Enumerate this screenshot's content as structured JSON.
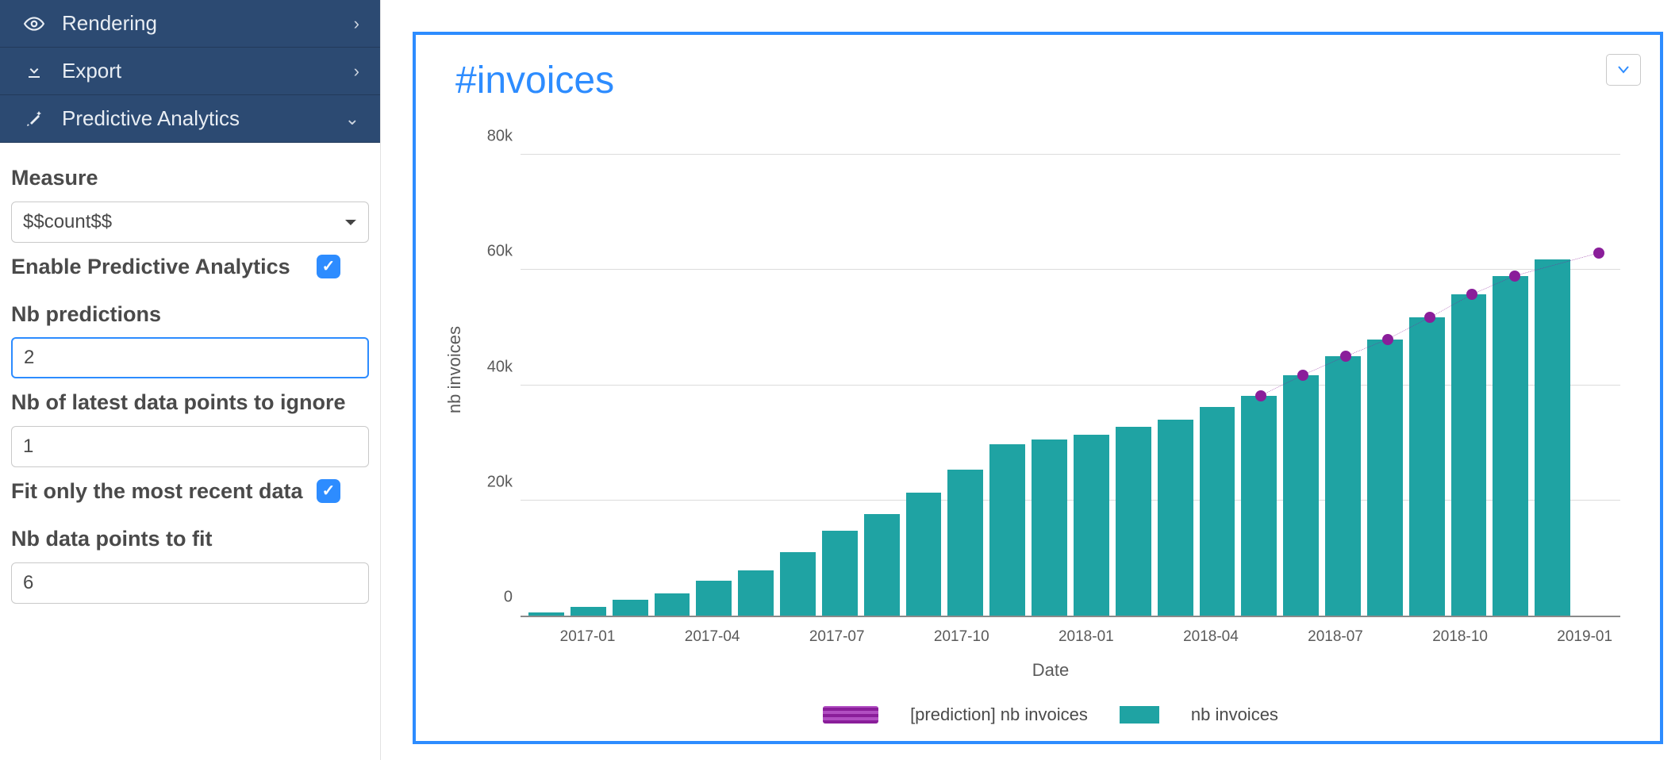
{
  "sidebar": {
    "nav": [
      {
        "label": "Rendering",
        "icon": "eye",
        "state": "collapsed"
      },
      {
        "label": "Export",
        "icon": "download",
        "state": "collapsed"
      },
      {
        "label": "Predictive Analytics",
        "icon": "wand",
        "state": "expanded"
      }
    ],
    "fields": {
      "measure_label": "Measure",
      "measure_value": "$$count$$",
      "enable_label": "Enable Predictive Analytics",
      "enable_checked": true,
      "nb_predictions_label": "Nb predictions",
      "nb_predictions_value": "2",
      "nb_ignore_label": "Nb of latest data points to ignore",
      "nb_ignore_value": "1",
      "fit_recent_label": "Fit only the most recent data",
      "fit_recent_checked": true,
      "nb_fit_label": "Nb data points to fit",
      "nb_fit_value": "6"
    }
  },
  "chart": {
    "title": "#invoices",
    "xlabel": "Date",
    "ylabel": "nb invoices",
    "legend_prediction": "[prediction] nb invoices",
    "legend_bar": "nb invoices"
  },
  "chart_data": {
    "type": "bar",
    "title": "#invoices",
    "xlabel": "Date",
    "ylabel": "nb invoices",
    "ylim": [
      0,
      85000
    ],
    "yticks": [
      0,
      20000,
      40000,
      60000,
      80000
    ],
    "ytick_labels": [
      "0",
      "20k",
      "40k",
      "60k",
      "80k"
    ],
    "categories": [
      "2016-12",
      "2017-01",
      "2017-02",
      "2017-03",
      "2017-04",
      "2017-05",
      "2017-06",
      "2017-07",
      "2017-08",
      "2017-09",
      "2017-10",
      "2017-11",
      "2017-12",
      "2018-01",
      "2018-02",
      "2018-03",
      "2018-04",
      "2018-05",
      "2018-06",
      "2018-07",
      "2018-08",
      "2018-09",
      "2018-10",
      "2018-11",
      "2018-12",
      "2019-01"
    ],
    "xtick_show": [
      "",
      "2017-01",
      "",
      "",
      "2017-04",
      "",
      "",
      "2017-07",
      "",
      "",
      "2017-10",
      "",
      "",
      "2018-01",
      "",
      "",
      "2018-04",
      "",
      "",
      "2018-07",
      "",
      "",
      "2018-10",
      "",
      "",
      "2019-01"
    ],
    "series": [
      {
        "name": "nb invoices",
        "type": "bar",
        "color": "#1fa3a3",
        "values": [
          500,
          1500,
          2800,
          3900,
          6100,
          7800,
          11000,
          14800,
          17600,
          21400,
          25400,
          29800,
          30600,
          31400,
          32800,
          34000,
          36200,
          38200,
          41800,
          45000,
          48000,
          51800,
          55800,
          59000,
          61800,
          null
        ]
      },
      {
        "name": "[prediction] nb invoices",
        "type": "line",
        "color": "#8a1e9a",
        "values": [
          null,
          null,
          null,
          null,
          null,
          null,
          null,
          null,
          null,
          null,
          null,
          null,
          null,
          null,
          null,
          null,
          null,
          38200,
          41800,
          45000,
          48000,
          51800,
          55800,
          59000,
          null,
          63000
        ]
      }
    ]
  }
}
